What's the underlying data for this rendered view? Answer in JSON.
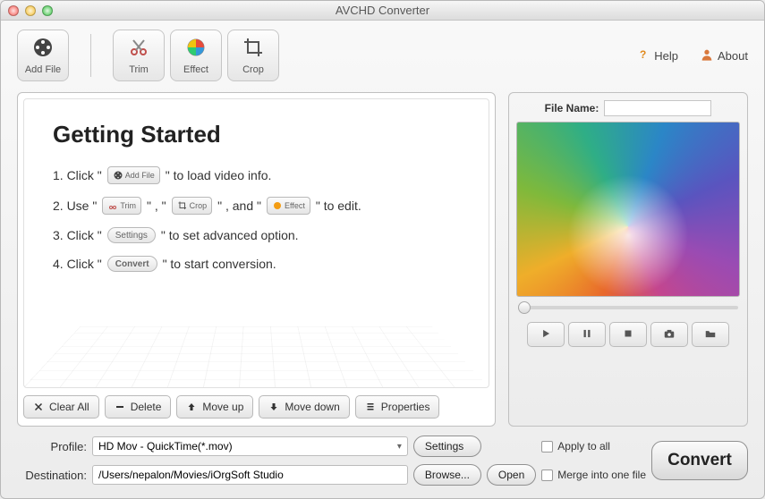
{
  "window": {
    "title": "AVCHD Converter"
  },
  "toolbar": {
    "add_file": "Add File",
    "trim": "Trim",
    "effect": "Effect",
    "crop": "Crop",
    "help": "Help",
    "about": "About"
  },
  "getting_started": {
    "title": "Getting Started",
    "step1_a": "1. Click \"",
    "step1_b": "\" to load video info.",
    "step2_a": "2. Use \"",
    "step2_b": "\" , \"",
    "step2_c": "\" , and \"",
    "step2_d": "\" to edit.",
    "step3_a": "3. Click \"",
    "step3_b": "\" to set advanced option.",
    "step4_a": "4. Click \"",
    "step4_b": "\" to start conversion.",
    "mini_addfile": "Add File",
    "mini_trim": "Trim",
    "mini_crop": "Crop",
    "mini_effect": "Effect",
    "mini_settings": "Settings",
    "mini_convert": "Convert"
  },
  "actions": {
    "clear_all": "Clear All",
    "delete": "Delete",
    "move_up": "Move up",
    "move_down": "Move down",
    "properties": "Properties"
  },
  "preview": {
    "file_name_label": "File Name:",
    "file_name_value": ""
  },
  "bottom": {
    "profile_label": "Profile:",
    "profile_value": "HD Mov - QuickTime(*.mov)",
    "settings": "Settings",
    "apply_to_all": "Apply to all",
    "destination_label": "Destination:",
    "destination_value": "/Users/nepalon/Movies/iOrgSoft Studio",
    "browse": "Browse...",
    "open": "Open",
    "merge": "Merge into one file",
    "convert": "Convert"
  }
}
